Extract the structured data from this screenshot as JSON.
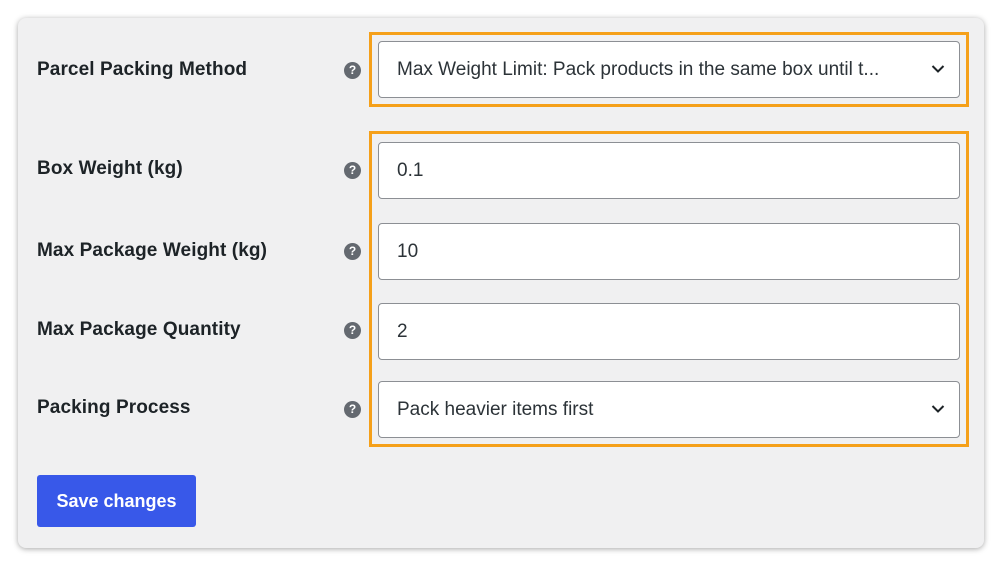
{
  "fields": {
    "parcel_packing_method": {
      "label": "Parcel Packing Method",
      "value": "Max Weight Limit: Pack products in the same box until t..."
    },
    "box_weight": {
      "label": "Box Weight (kg)",
      "value": "0.1"
    },
    "max_package_weight": {
      "label": "Max Package Weight (kg)",
      "value": "10"
    },
    "max_package_quantity": {
      "label": "Max Package Quantity",
      "value": "2"
    },
    "packing_process": {
      "label": "Packing Process",
      "value": "Pack heavier items first"
    }
  },
  "help_glyph": "?",
  "save_label": "Save changes",
  "colors": {
    "highlight": "#f5a01a",
    "primary_button": "#3858e9",
    "panel_background": "#f0f0f1",
    "help_icon": "#646970"
  },
  "icons": {
    "help": "question-circle-icon",
    "dropdown": "chevron-down-icon"
  }
}
